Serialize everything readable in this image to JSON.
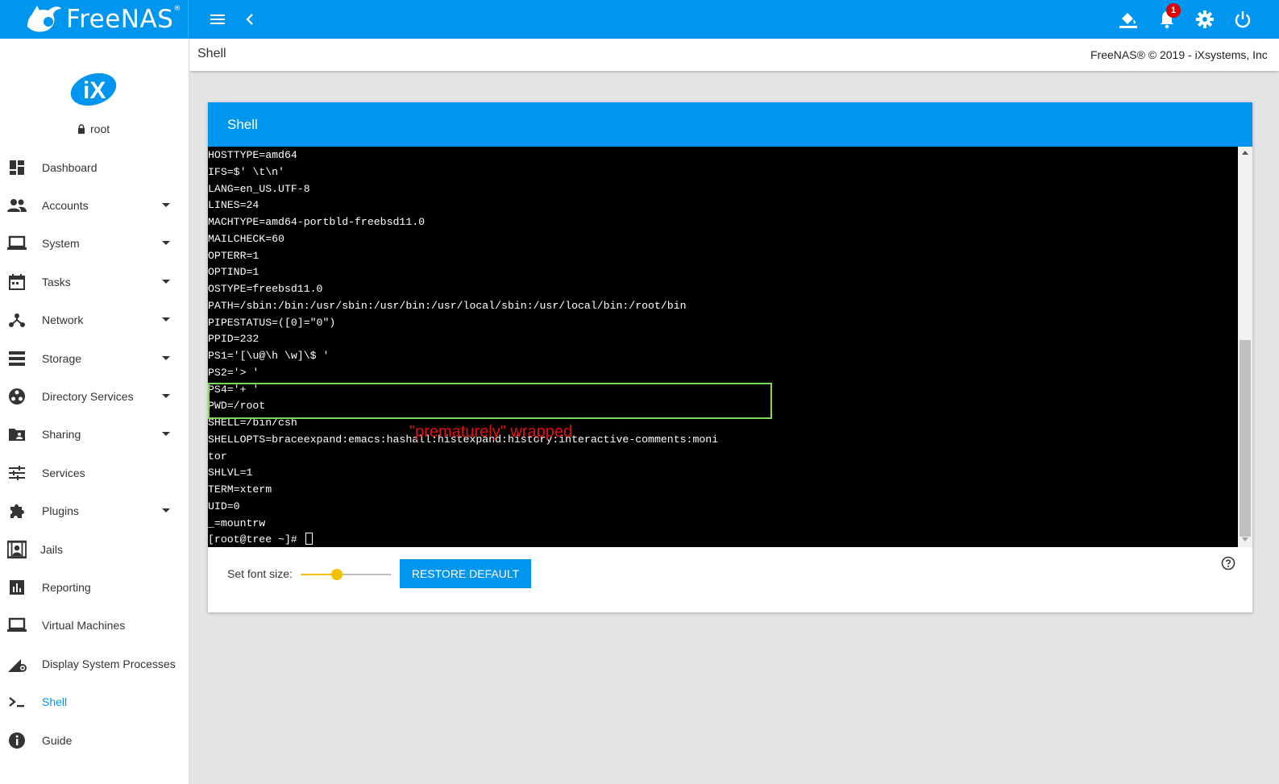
{
  "app": {
    "brand": "FreeNAS",
    "brand_mark": "®",
    "notification_count": "1",
    "accent": "#0095ee"
  },
  "header": {
    "page_title": "Shell",
    "copyright": "FreeNAS® © 2019 - iXsystems, Inc"
  },
  "topbar_icons": [
    "menu-icon",
    "chevron-left-icon",
    "theme-bucket-icon",
    "bell-icon",
    "gear-icon",
    "power-icon"
  ],
  "sidebar": {
    "user": "root",
    "items": [
      {
        "label": "Dashboard",
        "icon": "dashboard-icon",
        "has_submenu": false
      },
      {
        "label": "Accounts",
        "icon": "people-icon",
        "has_submenu": true
      },
      {
        "label": "System",
        "icon": "laptop-icon",
        "has_submenu": true
      },
      {
        "label": "Tasks",
        "icon": "calendar-icon",
        "has_submenu": true
      },
      {
        "label": "Network",
        "icon": "network-icon",
        "has_submenu": true
      },
      {
        "label": "Storage",
        "icon": "storage-icon",
        "has_submenu": true
      },
      {
        "label": "Directory Services",
        "icon": "directory-icon",
        "has_submenu": true
      },
      {
        "label": "Sharing",
        "icon": "shared-folder-icon",
        "has_submenu": true
      },
      {
        "label": "Services",
        "icon": "tune-icon",
        "has_submenu": false
      },
      {
        "label": "Plugins",
        "icon": "puzzle-icon",
        "has_submenu": true
      },
      {
        "label": "Jails",
        "icon": "jail-icon",
        "has_submenu": false
      },
      {
        "label": "Reporting",
        "icon": "bar-chart-icon",
        "has_submenu": false
      },
      {
        "label": "Virtual Machines",
        "icon": "laptop-icon",
        "has_submenu": false
      },
      {
        "label": "Display System Processes",
        "icon": "processes-icon",
        "has_submenu": false
      },
      {
        "label": "Shell",
        "icon": "console-icon",
        "has_submenu": false,
        "active": true
      },
      {
        "label": "Guide",
        "icon": "info-icon",
        "has_submenu": false
      }
    ]
  },
  "card": {
    "title": "Shell"
  },
  "terminal": {
    "lines": [
      "HOSTTYPE=amd64",
      "IFS=$' \\t\\n'",
      "LANG=en_US.UTF-8",
      "LINES=24",
      "MACHTYPE=amd64-portbld-freebsd11.0",
      "MAILCHECK=60",
      "OPTERR=1",
      "OPTIND=1",
      "OSTYPE=freebsd11.0",
      "PATH=/sbin:/bin:/usr/sbin:/usr/bin:/usr/local/sbin:/usr/local/bin:/root/bin",
      "PIPESTATUS=([0]=\"0\")",
      "PPID=232",
      "PS1='[\\u@\\h \\w]\\$ '",
      "PS2='> '",
      "PS4='+ '",
      "PWD=/root",
      "SHELL=/bin/csh",
      "SHELLOPTS=braceexpand:emacs:hashall:histexpand:history:interactive-comments:moni",
      "tor",
      "SHLVL=1",
      "TERM=xterm",
      "UID=0",
      "_=mountrw"
    ],
    "prompt": "[root@tree ~]# ",
    "annotation": "\"prematurely\" wrapped",
    "highlight_color": "#7ed957",
    "annotation_color": "#e01010"
  },
  "controls": {
    "font_size_label": "Set font size:",
    "font_size_value_fraction": 0.4,
    "slider_color": "#f2c200",
    "restore_label": "RESTORE DEFAULT"
  }
}
